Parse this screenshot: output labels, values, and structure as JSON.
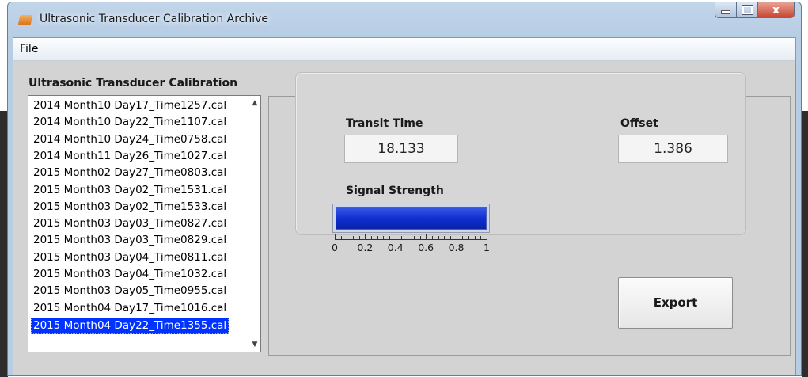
{
  "window": {
    "title": "Ultrasonic Transducer Calibration Archive",
    "icon": "app-icon",
    "buttons": {
      "minimize": "minimize",
      "maximize": "maximize",
      "close": "x"
    }
  },
  "menu": {
    "file": "File"
  },
  "calibration": {
    "section_title": "Ultrasonic Transducer Calibration",
    "files": [
      "2014 Month10 Day17_Time1257.cal",
      "2014 Month10 Day22_Time1107.cal",
      "2014 Month10 Day24_Time0758.cal",
      "2014 Month11 Day26_Time1027.cal",
      "2015 Month02 Day27_Time0803.cal",
      "2015 Month03 Day02_Time1531.cal",
      "2015 Month03 Day02_Time1533.cal",
      "2015 Month03 Day03_Time0827.cal",
      "2015 Month03 Day03_Time0829.cal",
      "2015 Month03 Day04_Time0811.cal",
      "2015 Month03 Day04_Time1032.cal",
      "2015 Month03 Day05_Time0955.cal",
      "2015 Month04 Day17_Time1016.cal",
      "2015 Month04 Day22_Time1355.cal"
    ],
    "selected_index": 13
  },
  "details": {
    "transit_time_label": "Transit Time",
    "transit_time_value": "18.133",
    "offset_label": "Offset",
    "offset_value": "1.386",
    "signal_strength_label": "Signal Strength",
    "signal_strength_level": 1.0,
    "signal_scale": [
      "0",
      "0.2",
      "0.4",
      "0.6",
      "0.8",
      "1"
    ]
  },
  "actions": {
    "export_label": "Export"
  },
  "colors": {
    "selection": "#0033ff",
    "gauge_fill": "#0f2fd0",
    "title_bar": "#c2d5e9",
    "close_button": "#c9462f"
  }
}
